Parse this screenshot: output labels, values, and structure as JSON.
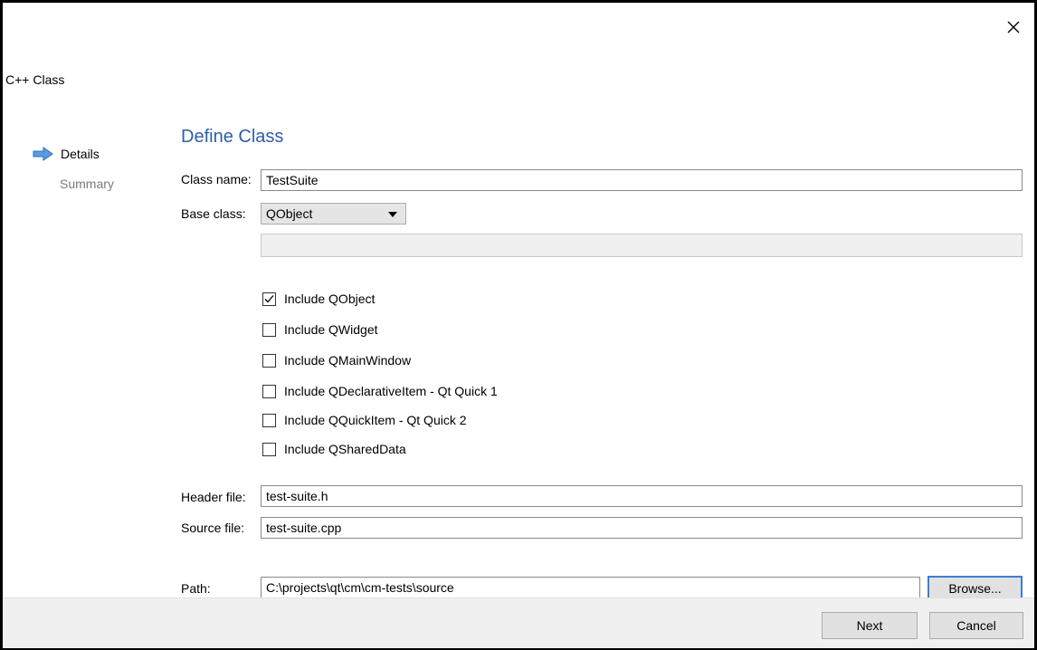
{
  "window": {
    "title": "C++ Class"
  },
  "sidebar": {
    "items": [
      "Details",
      "Summary"
    ]
  },
  "section_title": "Define Class",
  "form": {
    "class_name_label": "Class name:",
    "class_name_value": "TestSuite",
    "base_class_label": "Base class:",
    "base_class_value": "QObject",
    "base_class_extra_value": "",
    "checkboxes": [
      {
        "label": "Include QObject",
        "checked": true
      },
      {
        "label": "Include QWidget",
        "checked": false
      },
      {
        "label": "Include QMainWindow",
        "checked": false
      },
      {
        "label": "Include QDeclarativeItem - Qt Quick 1",
        "checked": false
      },
      {
        "label": "Include QQuickItem - Qt Quick 2",
        "checked": false
      },
      {
        "label": "Include QSharedData",
        "checked": false
      }
    ],
    "header_file_label": "Header file:",
    "header_file_value": "test-suite.h",
    "source_file_label": "Source file:",
    "source_file_value": "test-suite.cpp",
    "path_label": "Path:",
    "path_value": "C:\\projects\\qt\\cm\\cm-tests\\source",
    "browse_label": "Browse..."
  },
  "footer": {
    "next_label": "Next",
    "cancel_label": "Cancel"
  },
  "icons": {
    "close": "close-icon",
    "current_step": "arrow-right-icon",
    "dropdown": "chevron-down-icon",
    "check": "checkmark-icon"
  },
  "colors": {
    "accent": "#2f5ea7",
    "focus": "#3c7fd1",
    "footer_bg": "#f0f0f0"
  }
}
